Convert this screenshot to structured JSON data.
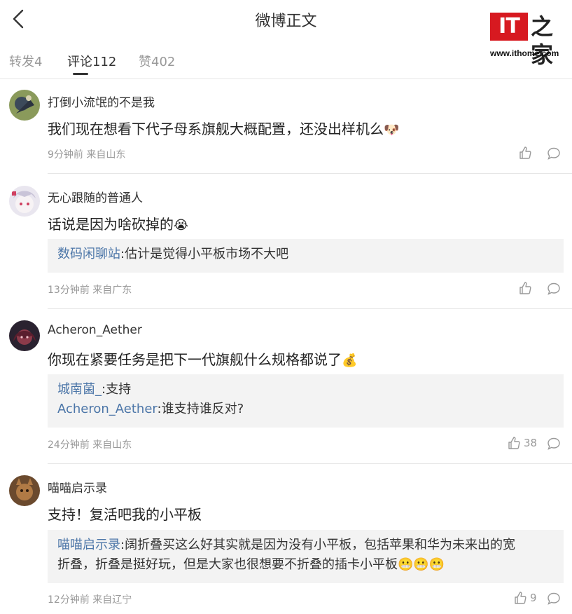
{
  "header": {
    "title": "微博正文",
    "back_icon": "chevron-left-icon"
  },
  "logo": {
    "brand": "IT之家",
    "it": "IT",
    "zh": "之家",
    "url": "www.ithome.com"
  },
  "tabs": [
    {
      "label": "转发4",
      "active": false
    },
    {
      "label": "评论112",
      "active": true
    },
    {
      "label": "赞402",
      "active": false
    }
  ],
  "comments": [
    {
      "username": "打倒小流氓的不是我",
      "content": "我们现在想看下代子母系旗舰大概配置，还没出样机么",
      "emoji": "🐶",
      "time": "9分钟前 来自山东",
      "likes": ""
    },
    {
      "username": "无心跟随的普通人",
      "content": "话说是因为啥砍掉的",
      "emoji": "😭",
      "replies": [
        {
          "user": "数码闲聊站",
          "text": ":估计是觉得小平板市场不大吧"
        }
      ],
      "time": "13分钟前 来自广东",
      "likes": ""
    },
    {
      "username": "Acheron_Aether",
      "content": "你现在紧要任务是把下一代旗舰什么规格都说了",
      "emoji": "💰",
      "replies": [
        {
          "user": "城南菌_",
          "text": ":支持"
        },
        {
          "user": "Acheron_Aether",
          "text": ":谁支持谁反对?"
        }
      ],
      "time": "24分钟前 来自山东",
      "likes": "38"
    },
    {
      "username": "喵喵启示录",
      "content": "支持！复活吧我的小平板",
      "emoji": "",
      "replies": [
        {
          "user": "喵喵启示录",
          "text": ":阔折叠买这么好其实就是因为没有小平板，包括苹果和华为未来出的宽",
          "text2": "折叠，折叠是挺好玩，但是大家也很想要不折叠的插卡小平板",
          "emoji": "😬😬😬"
        }
      ],
      "time": "12分钟前 来自辽宁",
      "likes": "9"
    }
  ]
}
